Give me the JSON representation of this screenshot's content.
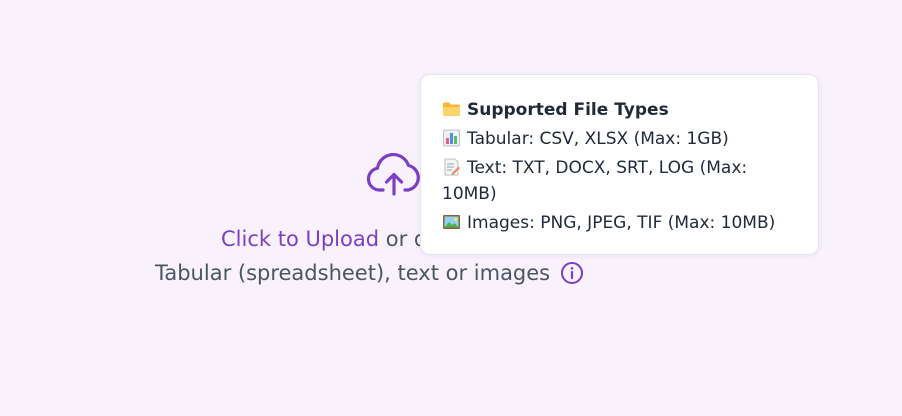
{
  "upload": {
    "link_text": "Click to Upload",
    "rest_text": " or d",
    "subtitle": "Tabular (spreadsheet), text or images",
    "icon": "cloud-upload-icon",
    "info_icon": "info-icon"
  },
  "tooltip": {
    "title": "Supported File Types",
    "title_icon": "folder-icon",
    "items": [
      {
        "icon": "bar-chart-icon",
        "text": "Tabular: CSV, XLSX (Max: 1GB)"
      },
      {
        "icon": "memo-icon",
        "text": "Text: TXT, DOCX, SRT, LOG (Max: 10MB)"
      },
      {
        "icon": "picture-icon",
        "text": "Images: PNG, JPEG, TIF (Max: 10MB)"
      }
    ]
  },
  "colors": {
    "background": "#f9f2fd",
    "accent": "#7b3fc4",
    "text": "#4b5563"
  }
}
